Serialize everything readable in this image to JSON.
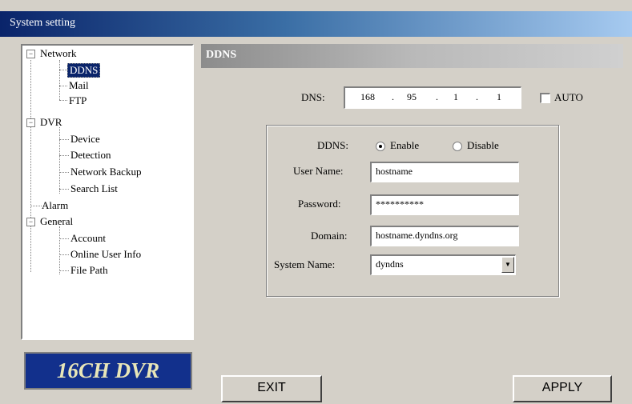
{
  "window": {
    "title": "System setting"
  },
  "tree": {
    "network": {
      "label": "Network",
      "expander": "−"
    },
    "ddns": "DDNS",
    "mail": "Mail",
    "ftp": "FTP",
    "dvr": {
      "label": "DVR",
      "expander": "−"
    },
    "device": "Device",
    "detection": "Detection",
    "network_backup": "Network Backup",
    "search_list": "Search List",
    "alarm": "Alarm",
    "general": {
      "label": "General",
      "expander": "−"
    },
    "account": "Account",
    "online_user_info": "Online User Info",
    "file_path": "File Path"
  },
  "logo": "16CH DVR",
  "section": {
    "title": "DDNS"
  },
  "dns": {
    "label": "DNS:",
    "octets": [
      "168",
      "95",
      "1",
      "1"
    ],
    "auto_label": "AUTO",
    "auto_checked": false
  },
  "ddns": {
    "label": "DDNS:",
    "enable_label": "Enable",
    "disable_label": "Disable",
    "selected": "Enable",
    "user_name_label": "User Name:",
    "user_name_value": "hostname",
    "password_label": "Password:",
    "password_value": "**********",
    "domain_label": "Domain:",
    "domain_value": "hostname.dyndns.org",
    "system_name_label": "System Name:",
    "system_name_value": "dyndns"
  },
  "buttons": {
    "exit": "EXIT",
    "apply": "APPLY"
  }
}
